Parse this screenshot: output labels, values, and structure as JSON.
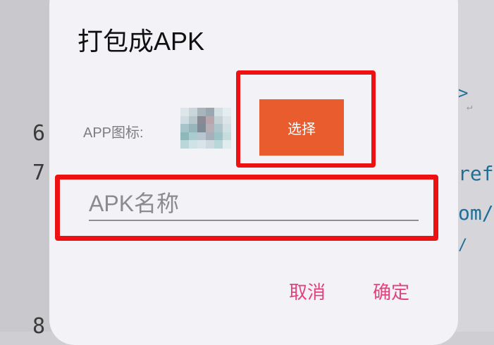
{
  "background_editor": {
    "line_numbers": [
      "6",
      "7",
      "8"
    ],
    "code_fragments": [
      ">",
      "↵",
      "ref",
      "om/",
      "/"
    ]
  },
  "dialog": {
    "title": "打包成APK",
    "icon_label": "APP图标:",
    "select_button_label": "选择",
    "name_input_placeholder": "APK名称",
    "name_input_value": "",
    "cancel_label": "取消",
    "ok_label": "确定"
  },
  "colors": {
    "accent": "#e0457a",
    "select_button": "#e85c2e",
    "highlight_border": "#ee1111"
  }
}
